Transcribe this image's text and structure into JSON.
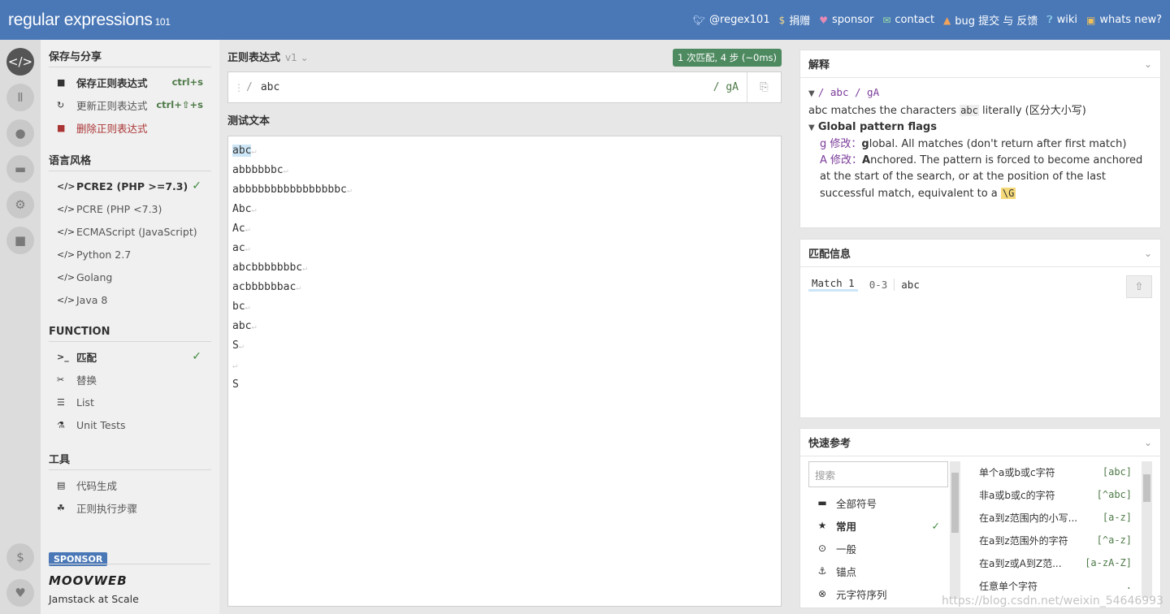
{
  "header": {
    "logo_main": "regular expressions",
    "logo_ver": "101",
    "nav": [
      {
        "icon": "twitter-icon",
        "label": "@regex101"
      },
      {
        "icon": "dollar-icon",
        "label": "捐赠"
      },
      {
        "icon": "heart-icon",
        "label": "sponsor"
      },
      {
        "icon": "mail-icon",
        "label": "contact"
      },
      {
        "icon": "warning-icon",
        "label": "bug 提交 与 反馈"
      },
      {
        "icon": "help-icon",
        "label": "wiki"
      },
      {
        "icon": "gift-icon",
        "label": "whats new?"
      }
    ]
  },
  "sidebar": {
    "save_title": "保存与分享",
    "save_items": [
      {
        "label": "保存正则表达式",
        "shortcut": "ctrl+s"
      },
      {
        "label": "更新正则表达式",
        "shortcut": "ctrl+⇧+s"
      },
      {
        "label": "删除正则表达式"
      }
    ],
    "flavor_title": "语言风格",
    "flavors": [
      "PCRE2 (PHP >=7.3)",
      "PCRE (PHP <7.3)",
      "ECMAScript (JavaScript)",
      "Python 2.7",
      "Golang",
      "Java 8"
    ],
    "function_title": "FUNCTION",
    "functions": [
      "匹配",
      "替换",
      "List",
      "Unit Tests"
    ],
    "tools_title": "工具",
    "tools": [
      "代码生成",
      "正则执行步骤"
    ],
    "sponsor_badge": "SPONSOR",
    "sponsor_name": "MOOVWEB",
    "sponsor_tag": "Jamstack at Scale"
  },
  "editor": {
    "regex_label": "正则表达式",
    "version": "v1",
    "match_info": "1 次匹配, 4 步 (~0ms)",
    "pattern": "abc",
    "flags": "gA",
    "test_label": "测试文本",
    "test_lines": [
      "abc",
      "abbbbbbc",
      "abbbbbbbbbbbbbbbbc",
      "Abc",
      "Ac",
      "ac",
      "abcbbbbbbbc",
      "acbbbbbbac",
      "bc",
      "abc",
      "S",
      "",
      "S"
    ]
  },
  "explanation": {
    "title": "解释",
    "root": "/ abc / gA",
    "line1_code": "abc",
    "line1_pre": "abc matches the characters",
    "line1_post": "literally (区分大小写)",
    "flags_title": "Global pattern flags",
    "g_mod": "g 修改：",
    "g_bold": "g",
    "g_text": "lobal. All matches (don't return after first match)",
    "a_mod": "A 修改：",
    "a_bold": "A",
    "a_text": "nchored. The pattern is forced to become anchored at the start of the search, or at the position of the last successful match, equivalent to a",
    "a_code": "\\G"
  },
  "match_panel": {
    "title": "匹配信息",
    "match_label": "Match 1",
    "range": "0-3",
    "value": "abc"
  },
  "quickref": {
    "title": "快速参考",
    "search_placeholder": "搜索",
    "categories": [
      {
        "icon": "stack-icon",
        "label": "全部符号"
      },
      {
        "icon": "star-icon",
        "label": "常用"
      },
      {
        "icon": "circle-dot-icon",
        "label": "一般"
      },
      {
        "icon": "anchor-icon",
        "label": "锚点"
      },
      {
        "icon": "x-circle-icon",
        "label": "元字符序列"
      }
    ],
    "items": [
      {
        "label": "单个a或b或c字符",
        "token": "[abc]"
      },
      {
        "label": "非a或b或c的字符",
        "token": "[^abc]"
      },
      {
        "label": "在a到z范围内的小写...",
        "token": "[a-z]"
      },
      {
        "label": "在a到z范围外的字符",
        "token": "[^a-z]"
      },
      {
        "label": "在a到z或A到Z范...",
        "token": "[a-zA-Z]"
      },
      {
        "label": "任意单个字符",
        "token": "."
      }
    ]
  },
  "watermark": "https://blog.csdn.net/weixin_54646993"
}
